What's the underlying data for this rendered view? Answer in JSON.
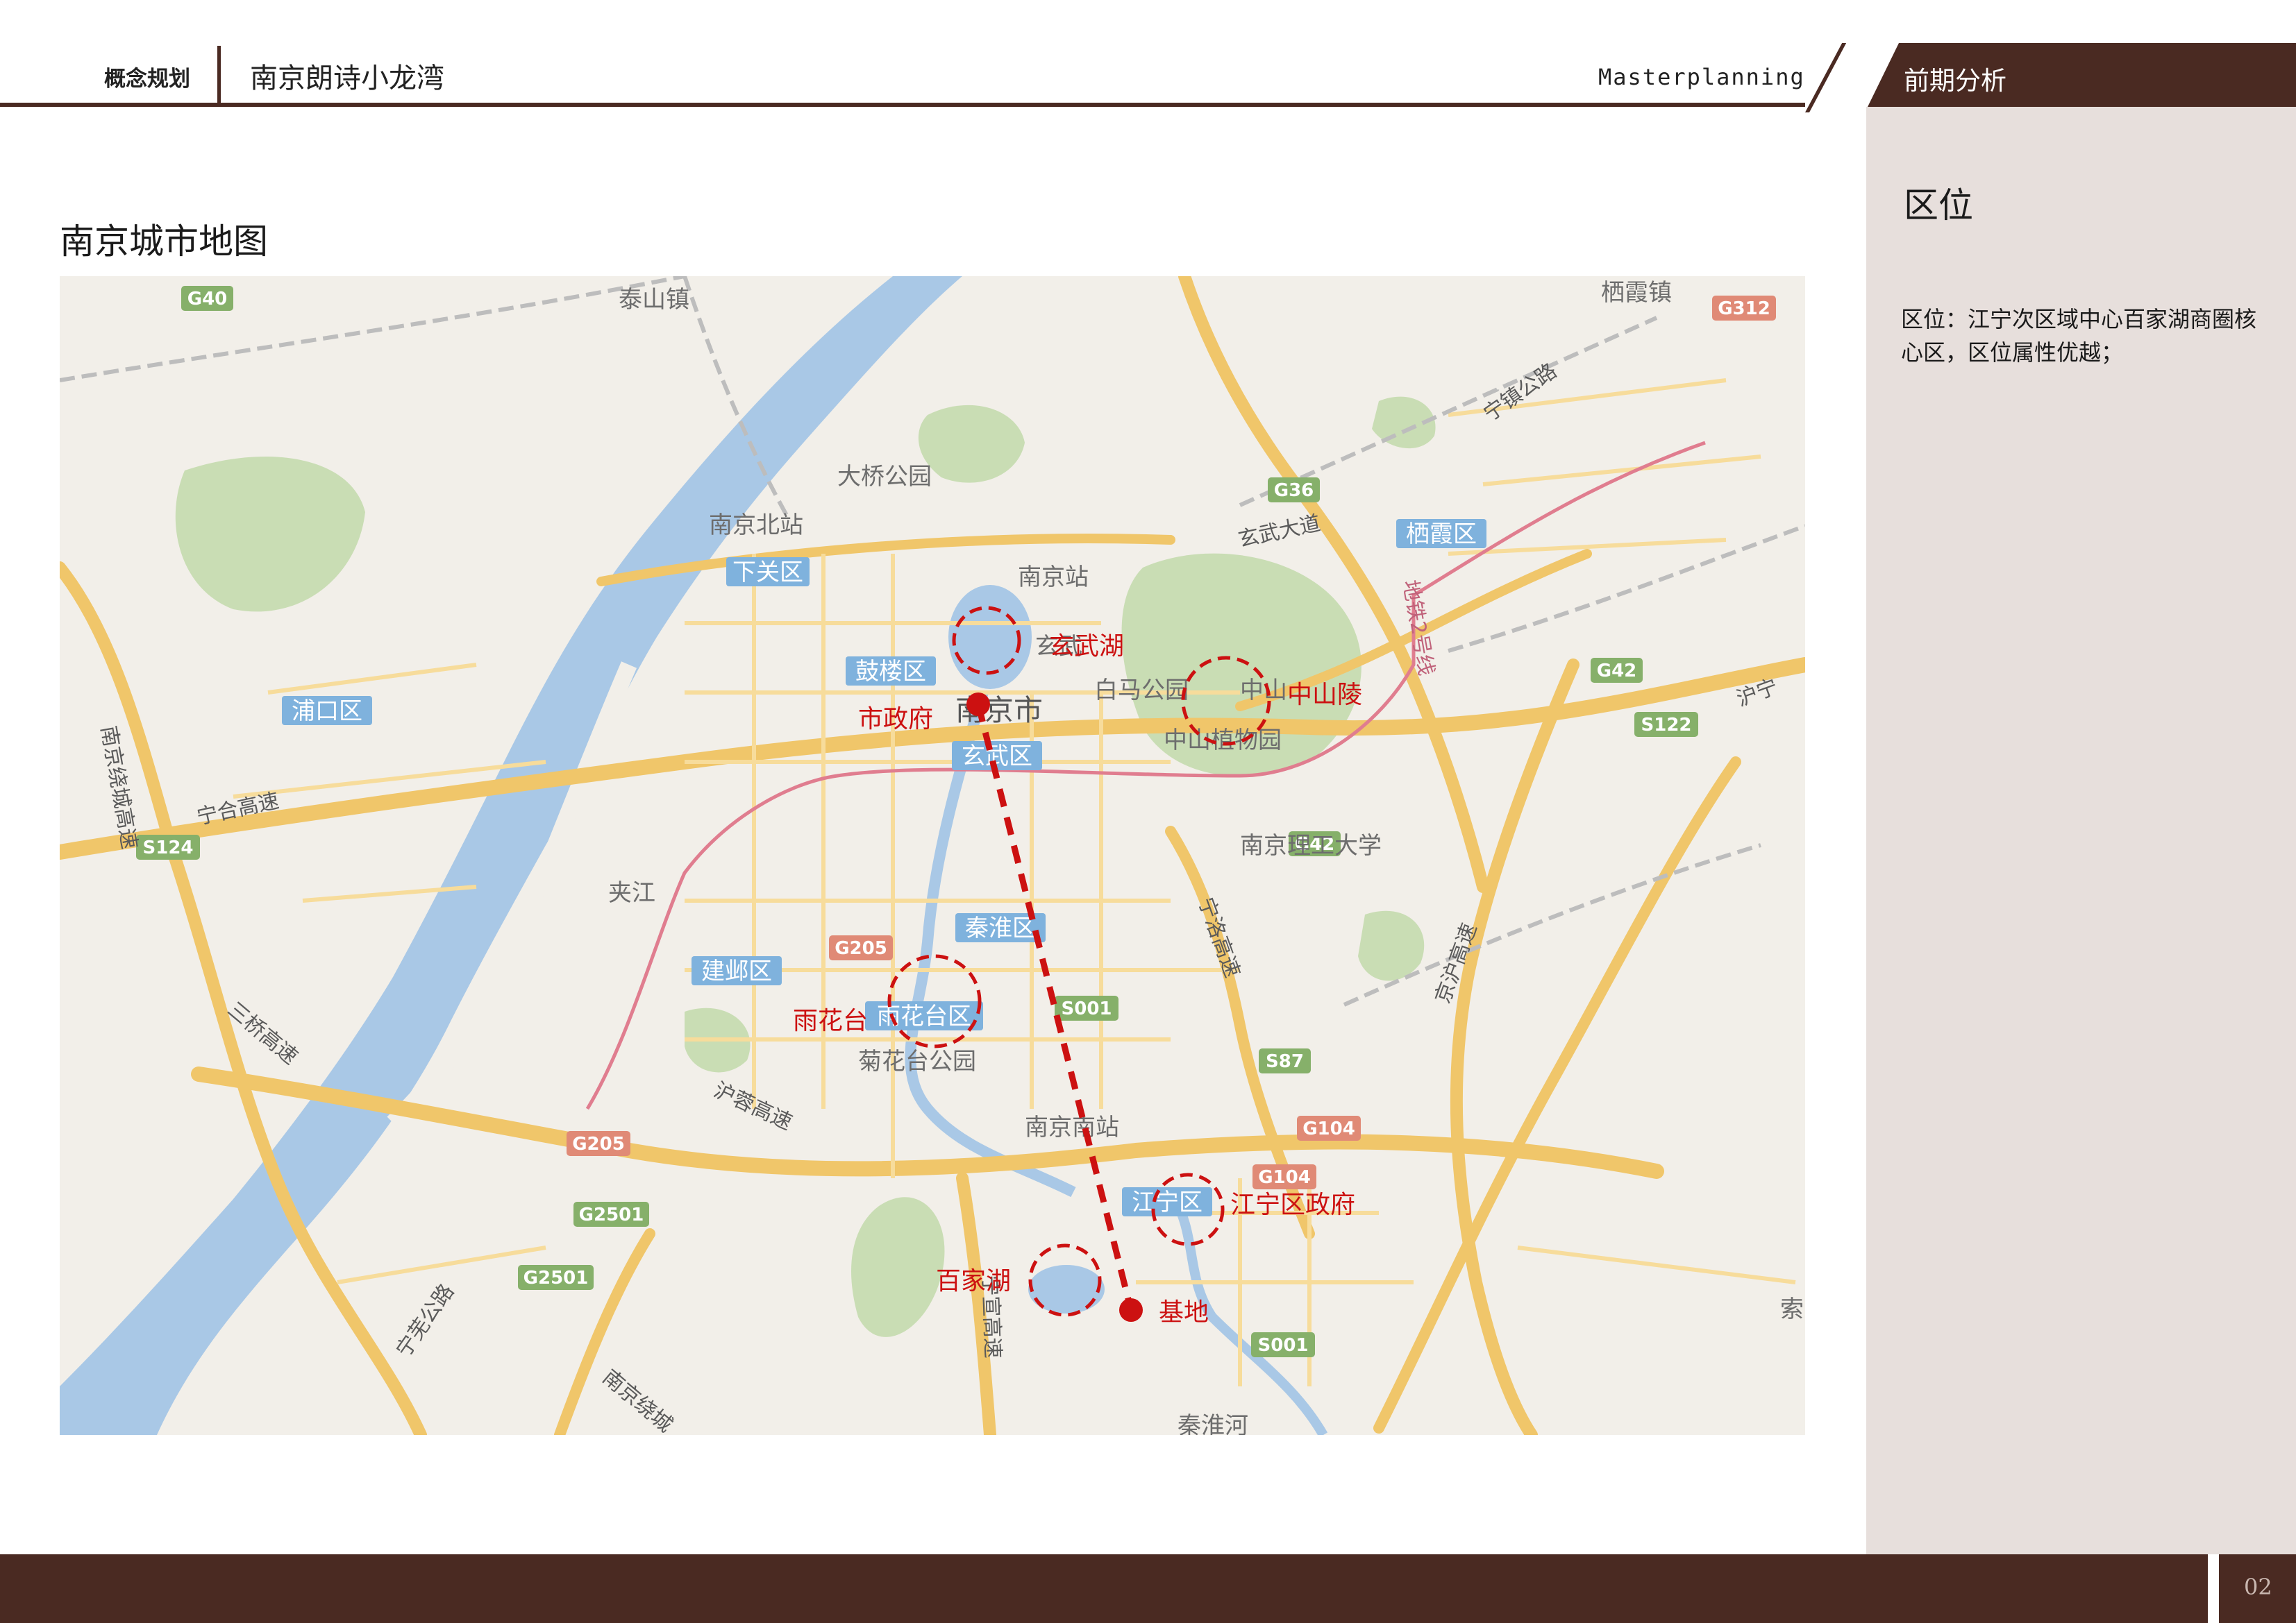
{
  "header": {
    "concept_label": "概念规划",
    "project_name": "南京朗诗小龙湾",
    "masterplanning": "Masterplanning",
    "section": "前期分析"
  },
  "sidebar": {
    "title": "区位",
    "description": "区位：江宁次区域中心百家湖商圈核心区，区位属性优越；"
  },
  "map": {
    "title": "南京城市地图",
    "annotations": {
      "xuanwu_lake": "玄武湖",
      "zhongshan_mausoleum": "中山陵",
      "city_government": "市政府",
      "yuhuatai": "雨花台",
      "jiangning_government": "江宁区政府",
      "baijia_lake": "百家湖",
      "site": "基地"
    },
    "districts": {
      "xiaguan": "下关区",
      "gulou": "鼓楼区",
      "xuanwu": "玄武区",
      "pukou": "浦口区",
      "qinhuai": "秦淮区",
      "jianye": "建邺区",
      "yuhuatai": "雨花台区",
      "jiangning": "江宁区",
      "qixia": "栖霞区"
    },
    "places": {
      "taishan_town": "泰山镇",
      "qixia_town": "栖霞镇",
      "daqiao_park": "大桥公园",
      "nanjing_north_station": "南京北站",
      "nanjing_station": "南京站",
      "city": "南京市",
      "baima_park": "白马公园",
      "zhongshan_garden": "中山植物园",
      "zhongshan_short": "中山",
      "xuanwu_short": "玄武",
      "nust": "南京理工大学",
      "jiajiang": "夹江",
      "juhuatai_park": "菊花台公园",
      "nanjing_south_station": "南京南站",
      "qinhuai_river": "秦淮河",
      "suo": "索"
    },
    "roads": {
      "xuanwu_avenue": "玄武大道",
      "ningqi_highway": "宁镇公路",
      "ninghe_expressway": "宁合高速",
      "nanjing_ring": "南京绕城高速",
      "sanqiao": "三桥高速",
      "hurong": "沪蓉高速",
      "ningxuan": "宁宣高速",
      "ningwu": "宁芜公路",
      "nanjing_ring_south": "南京绕城",
      "huning": "沪宁",
      "metro_line2": "地铁2号线",
      "ningluo": "宁洛高速",
      "beijing_hu": "京沪高速"
    },
    "shields": [
      "G40",
      "G312",
      "G36",
      "G42",
      "S122",
      "G42",
      "S124",
      "G205",
      "S001",
      "S87",
      "G104",
      "G104",
      "G205",
      "G2501",
      "G2501",
      "S001"
    ]
  },
  "footer": {
    "page": "02"
  },
  "colors": {
    "brand_brown": "#4a2a22",
    "annotation_red": "#cc1111",
    "sidebar_bg": "#e7dfdc"
  }
}
